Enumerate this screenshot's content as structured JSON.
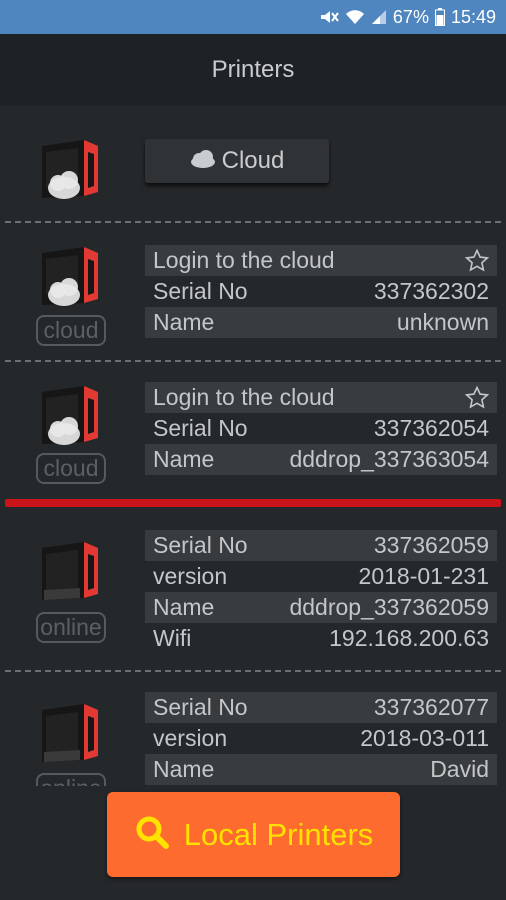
{
  "status_bar": {
    "battery": "67%",
    "time": "15:49",
    "icons": [
      "mute-icon",
      "wifi-icon",
      "signal-icon",
      "battery-icon"
    ]
  },
  "app_bar": {
    "title": "Printers"
  },
  "cloud_button": {
    "label": "Cloud",
    "icon": "cloud-icon"
  },
  "printers": [
    {
      "lines": [
        {
          "label": "Login to the cloud",
          "value": "",
          "star": true
        },
        {
          "label": "Serial No",
          "value": "337362302"
        },
        {
          "label": "Name",
          "value": "unknown"
        }
      ],
      "tag": "cloud"
    },
    {
      "lines": [
        {
          "label": "Login to the cloud",
          "value": "",
          "star": true
        },
        {
          "label": "Serial No",
          "value": "337362054"
        },
        {
          "label": "Name",
          "value": "dddrop_337363054"
        }
      ],
      "tag": "cloud"
    },
    {
      "lines": [
        {
          "label": "Serial No",
          "value": "337362059"
        },
        {
          "label": "version",
          "value": "2018-01-231"
        },
        {
          "label": "Name",
          "value": "dddrop_337362059"
        },
        {
          "label": "Wifi",
          "value": "192.168.200.63"
        }
      ],
      "tag": "online"
    },
    {
      "lines": [
        {
          "label": "Serial No",
          "value": "337362077"
        },
        {
          "label": "version",
          "value": "2018-03-011"
        },
        {
          "label": "Name",
          "value": "David"
        }
      ],
      "tag": "online"
    }
  ],
  "fab": {
    "label": "Local Printers",
    "icon": "search-icon"
  },
  "colors": {
    "status_bar": "#4f86c0",
    "accent_red": "#c9141a",
    "fab_bg": "#fd6c2e",
    "fab_text": "#ffe200"
  }
}
